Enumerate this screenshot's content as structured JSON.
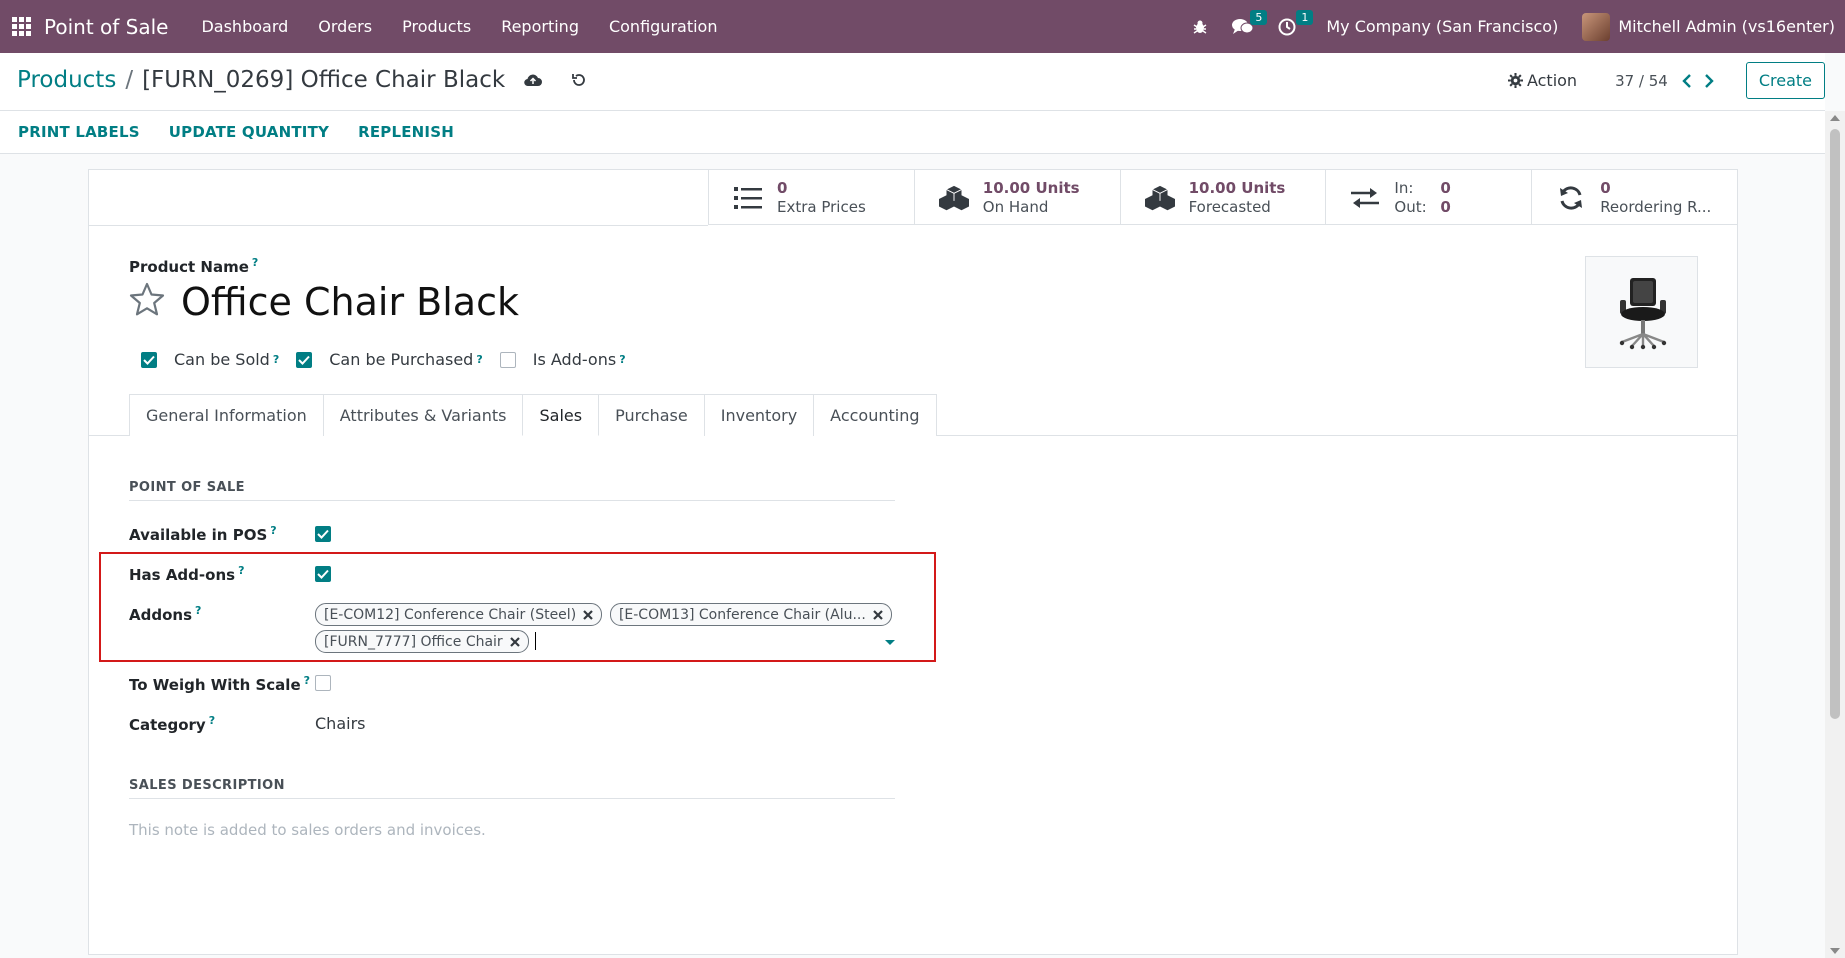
{
  "navbar": {
    "app_name": "Point of Sale",
    "menu": [
      "Dashboard",
      "Orders",
      "Products",
      "Reporting",
      "Configuration"
    ],
    "messages_count": "5",
    "activities_count": "1",
    "company": "My Company (San Francisco)",
    "user": "Mitchell Admin (vs16enter)"
  },
  "breadcrumb": {
    "parent": "Products",
    "current": "[FURN_0269] Office Chair Black"
  },
  "control_panel": {
    "action_label": "Action",
    "pager": "37 / 54",
    "create_label": "Create"
  },
  "statusbar": {
    "buttons": [
      "PRINT LABELS",
      "UPDATE QUANTITY",
      "REPLENISH"
    ]
  },
  "smart_buttons": {
    "extra_prices": {
      "value": "0",
      "label": "Extra Prices"
    },
    "on_hand": {
      "value": "10.00 Units",
      "label": "On Hand"
    },
    "forecasted": {
      "value": "10.00 Units",
      "label": "Forecasted"
    },
    "moves": {
      "in_label": "In:",
      "in_value": "0",
      "out_label": "Out:",
      "out_value": "0"
    },
    "reordering": {
      "value": "0",
      "label": "Reordering R..."
    }
  },
  "product": {
    "name_label": "Product Name",
    "name": "Office Chair Black",
    "can_be_sold_label": "Can be Sold",
    "can_be_sold": true,
    "can_be_purchased_label": "Can be Purchased",
    "can_be_purchased": true,
    "is_addons_label": "Is Add-ons",
    "is_addons": false
  },
  "tabs": [
    "General Information",
    "Attributes & Variants",
    "Sales",
    "Purchase",
    "Inventory",
    "Accounting"
  ],
  "active_tab": "Sales",
  "sales_tab": {
    "pos_section": "POINT OF SALE",
    "available_in_pos_label": "Available in POS",
    "available_in_pos": true,
    "has_addons_label": "Has Add-ons",
    "has_addons": true,
    "addons_label": "Addons",
    "addons": [
      "[E-COM12] Conference Chair (Steel)",
      "[E-COM13] Conference Chair (Alu...",
      "[FURN_7777] Office Chair"
    ],
    "weigh_label": "To Weigh With Scale",
    "weigh": false,
    "category_label": "Category",
    "category_value": "Chairs",
    "sales_desc_section": "SALES DESCRIPTION",
    "sales_desc_placeholder": "This note is added to sales orders and invoices."
  },
  "colors": {
    "brand": "#714b67",
    "accent": "#017e84",
    "highlight": "#d31919"
  }
}
